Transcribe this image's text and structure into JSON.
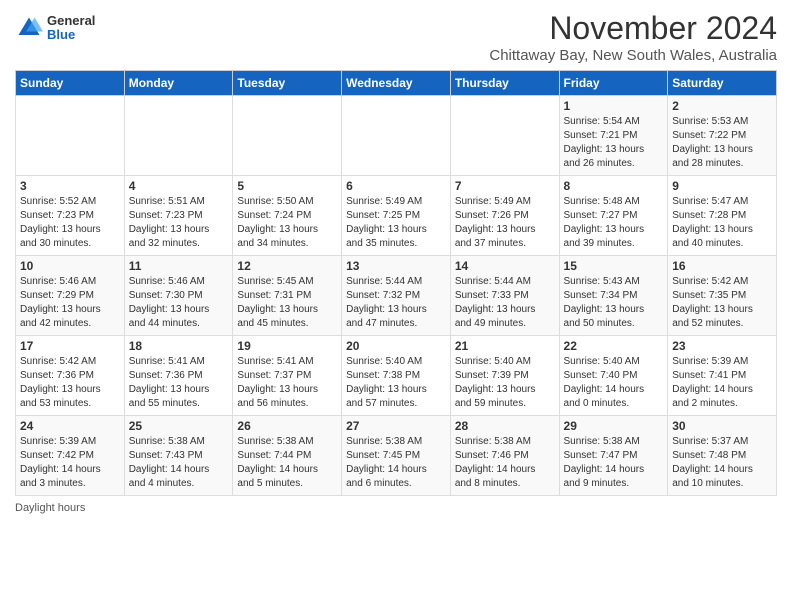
{
  "header": {
    "logo_general": "General",
    "logo_blue": "Blue",
    "title": "November 2024",
    "subtitle": "Chittaway Bay, New South Wales, Australia"
  },
  "days_of_week": [
    "Sunday",
    "Monday",
    "Tuesday",
    "Wednesday",
    "Thursday",
    "Friday",
    "Saturday"
  ],
  "weeks": [
    [
      {
        "day": "",
        "info": ""
      },
      {
        "day": "",
        "info": ""
      },
      {
        "day": "",
        "info": ""
      },
      {
        "day": "",
        "info": ""
      },
      {
        "day": "",
        "info": ""
      },
      {
        "day": "1",
        "info": "Sunrise: 5:54 AM\nSunset: 7:21 PM\nDaylight: 13 hours and 26 minutes."
      },
      {
        "day": "2",
        "info": "Sunrise: 5:53 AM\nSunset: 7:22 PM\nDaylight: 13 hours and 28 minutes."
      }
    ],
    [
      {
        "day": "3",
        "info": "Sunrise: 5:52 AM\nSunset: 7:23 PM\nDaylight: 13 hours and 30 minutes."
      },
      {
        "day": "4",
        "info": "Sunrise: 5:51 AM\nSunset: 7:23 PM\nDaylight: 13 hours and 32 minutes."
      },
      {
        "day": "5",
        "info": "Sunrise: 5:50 AM\nSunset: 7:24 PM\nDaylight: 13 hours and 34 minutes."
      },
      {
        "day": "6",
        "info": "Sunrise: 5:49 AM\nSunset: 7:25 PM\nDaylight: 13 hours and 35 minutes."
      },
      {
        "day": "7",
        "info": "Sunrise: 5:49 AM\nSunset: 7:26 PM\nDaylight: 13 hours and 37 minutes."
      },
      {
        "day": "8",
        "info": "Sunrise: 5:48 AM\nSunset: 7:27 PM\nDaylight: 13 hours and 39 minutes."
      },
      {
        "day": "9",
        "info": "Sunrise: 5:47 AM\nSunset: 7:28 PM\nDaylight: 13 hours and 40 minutes."
      }
    ],
    [
      {
        "day": "10",
        "info": "Sunrise: 5:46 AM\nSunset: 7:29 PM\nDaylight: 13 hours and 42 minutes."
      },
      {
        "day": "11",
        "info": "Sunrise: 5:46 AM\nSunset: 7:30 PM\nDaylight: 13 hours and 44 minutes."
      },
      {
        "day": "12",
        "info": "Sunrise: 5:45 AM\nSunset: 7:31 PM\nDaylight: 13 hours and 45 minutes."
      },
      {
        "day": "13",
        "info": "Sunrise: 5:44 AM\nSunset: 7:32 PM\nDaylight: 13 hours and 47 minutes."
      },
      {
        "day": "14",
        "info": "Sunrise: 5:44 AM\nSunset: 7:33 PM\nDaylight: 13 hours and 49 minutes."
      },
      {
        "day": "15",
        "info": "Sunrise: 5:43 AM\nSunset: 7:34 PM\nDaylight: 13 hours and 50 minutes."
      },
      {
        "day": "16",
        "info": "Sunrise: 5:42 AM\nSunset: 7:35 PM\nDaylight: 13 hours and 52 minutes."
      }
    ],
    [
      {
        "day": "17",
        "info": "Sunrise: 5:42 AM\nSunset: 7:36 PM\nDaylight: 13 hours and 53 minutes."
      },
      {
        "day": "18",
        "info": "Sunrise: 5:41 AM\nSunset: 7:36 PM\nDaylight: 13 hours and 55 minutes."
      },
      {
        "day": "19",
        "info": "Sunrise: 5:41 AM\nSunset: 7:37 PM\nDaylight: 13 hours and 56 minutes."
      },
      {
        "day": "20",
        "info": "Sunrise: 5:40 AM\nSunset: 7:38 PM\nDaylight: 13 hours and 57 minutes."
      },
      {
        "day": "21",
        "info": "Sunrise: 5:40 AM\nSunset: 7:39 PM\nDaylight: 13 hours and 59 minutes."
      },
      {
        "day": "22",
        "info": "Sunrise: 5:40 AM\nSunset: 7:40 PM\nDaylight: 14 hours and 0 minutes."
      },
      {
        "day": "23",
        "info": "Sunrise: 5:39 AM\nSunset: 7:41 PM\nDaylight: 14 hours and 2 minutes."
      }
    ],
    [
      {
        "day": "24",
        "info": "Sunrise: 5:39 AM\nSunset: 7:42 PM\nDaylight: 14 hours and 3 minutes."
      },
      {
        "day": "25",
        "info": "Sunrise: 5:38 AM\nSunset: 7:43 PM\nDaylight: 14 hours and 4 minutes."
      },
      {
        "day": "26",
        "info": "Sunrise: 5:38 AM\nSunset: 7:44 PM\nDaylight: 14 hours and 5 minutes."
      },
      {
        "day": "27",
        "info": "Sunrise: 5:38 AM\nSunset: 7:45 PM\nDaylight: 14 hours and 6 minutes."
      },
      {
        "day": "28",
        "info": "Sunrise: 5:38 AM\nSunset: 7:46 PM\nDaylight: 14 hours and 8 minutes."
      },
      {
        "day": "29",
        "info": "Sunrise: 5:38 AM\nSunset: 7:47 PM\nDaylight: 14 hours and 9 minutes."
      },
      {
        "day": "30",
        "info": "Sunrise: 5:37 AM\nSunset: 7:48 PM\nDaylight: 14 hours and 10 minutes."
      }
    ]
  ],
  "footer": {
    "note": "Daylight hours"
  }
}
